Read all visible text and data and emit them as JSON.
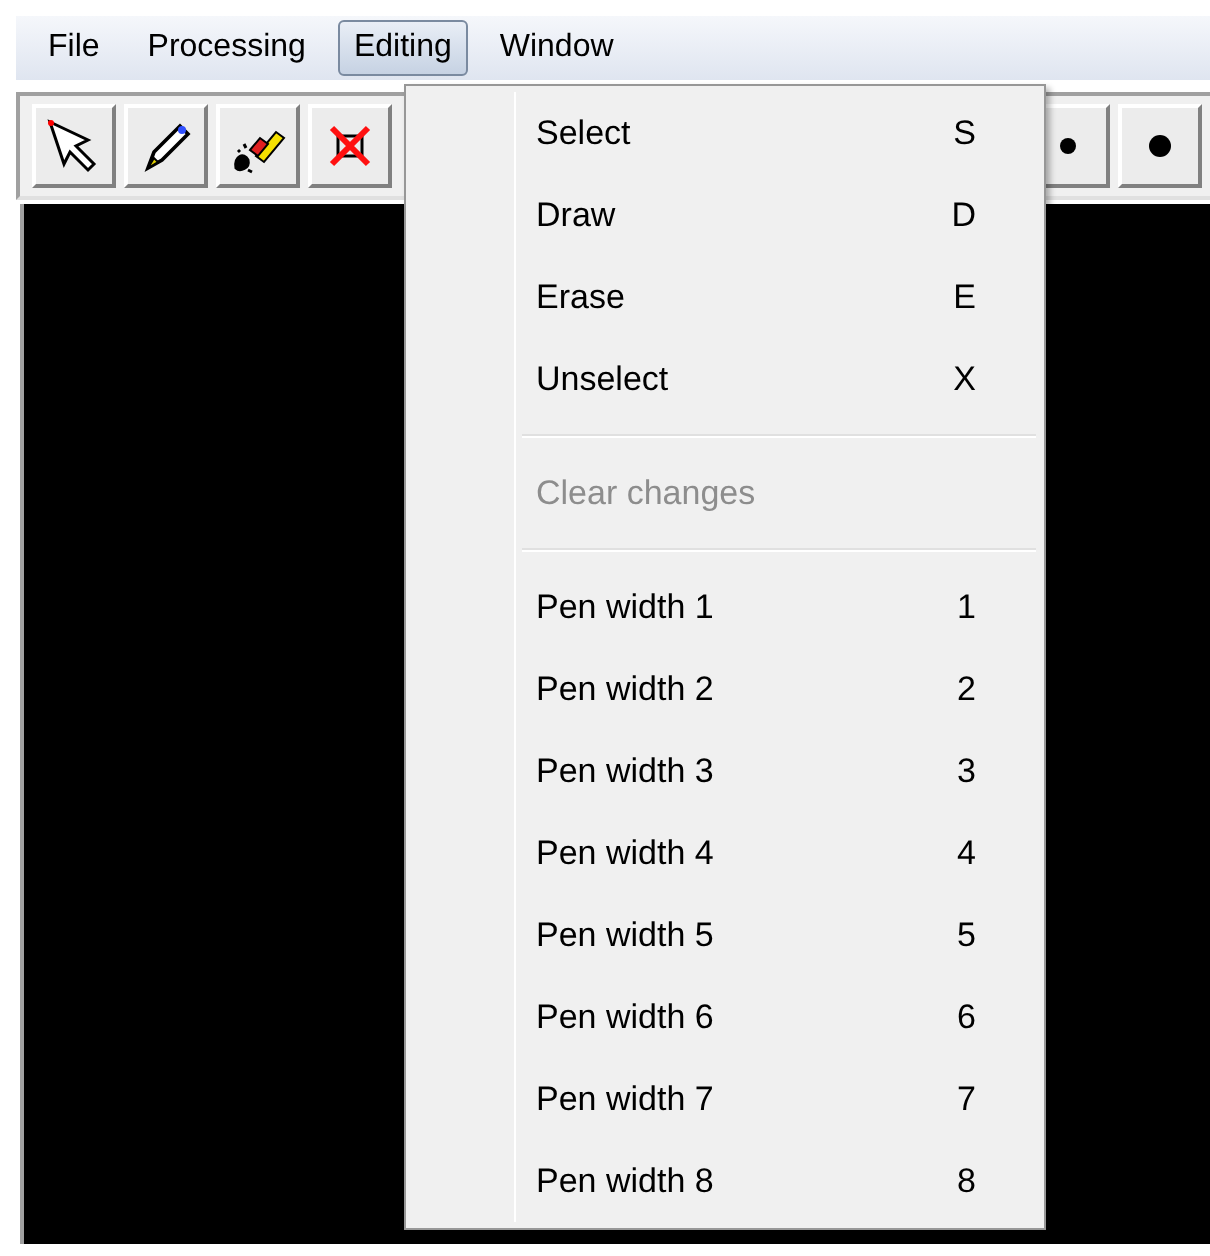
{
  "menu_bar": [
    {
      "label": "File",
      "selected": false
    },
    {
      "label": "Processing",
      "selected": false
    },
    {
      "label": "Editing",
      "selected": true
    },
    {
      "label": "Window",
      "selected": false
    }
  ],
  "editing_menu": [
    {
      "kind": "item",
      "label": "Select",
      "shortcut": "S",
      "disabled": false
    },
    {
      "kind": "item",
      "label": "Draw",
      "shortcut": "D",
      "disabled": false
    },
    {
      "kind": "item",
      "label": "Erase",
      "shortcut": "E",
      "disabled": false
    },
    {
      "kind": "item",
      "label": "Unselect",
      "shortcut": "X",
      "disabled": false
    },
    {
      "kind": "separator"
    },
    {
      "kind": "item",
      "label": "Clear changes",
      "disabled": true
    },
    {
      "kind": "separator"
    },
    {
      "kind": "item",
      "label": "Pen width 1",
      "shortcut": "1",
      "disabled": false
    },
    {
      "kind": "item",
      "label": "Pen width 2",
      "shortcut": "2",
      "disabled": false
    },
    {
      "kind": "item",
      "label": "Pen width 3",
      "shortcut": "3",
      "disabled": false
    },
    {
      "kind": "item",
      "label": "Pen width 4",
      "shortcut": "4",
      "disabled": false
    },
    {
      "kind": "item",
      "label": "Pen width 5",
      "shortcut": "5",
      "disabled": false
    },
    {
      "kind": "item",
      "label": "Pen width 6",
      "shortcut": "6",
      "disabled": false
    },
    {
      "kind": "item",
      "label": "Pen width 7",
      "shortcut": "7",
      "disabled": false
    },
    {
      "kind": "item",
      "label": "Pen width 8",
      "shortcut": "8",
      "disabled": false
    }
  ]
}
